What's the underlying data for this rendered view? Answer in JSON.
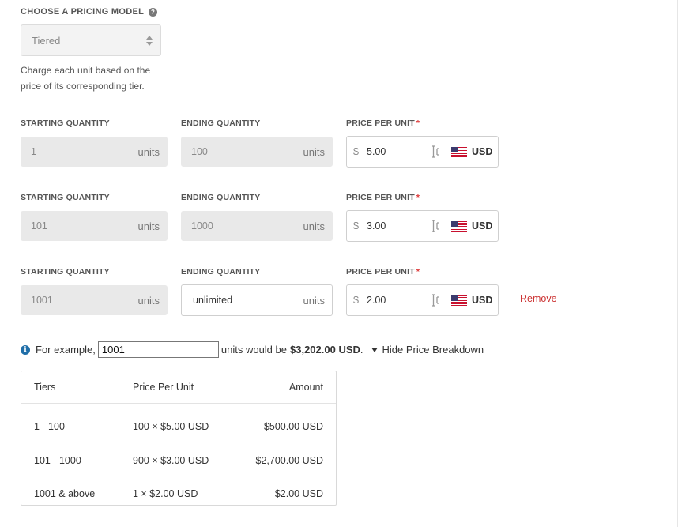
{
  "pricing_model": {
    "label": "CHOOSE A PRICING MODEL",
    "help_icon": "?",
    "selected": "Tiered",
    "description": "Charge each unit based on the price of its corresponding tier."
  },
  "columns": {
    "start": "STARTING QUANTITY",
    "end": "ENDING QUANTITY",
    "price": "PRICE PER UNIT",
    "required_mark": "*"
  },
  "tiers": [
    {
      "start": "1",
      "start_unit": "units",
      "end": "100",
      "end_unit": "units",
      "currency_symbol": "$",
      "price": "5.00",
      "currency": "USD"
    },
    {
      "start": "101",
      "start_unit": "units",
      "end": "1000",
      "end_unit": "units",
      "currency_symbol": "$",
      "price": "3.00",
      "currency": "USD"
    },
    {
      "start": "1001",
      "start_unit": "units",
      "end": "unlimited",
      "end_unit": "units",
      "currency_symbol": "$",
      "price": "2.00",
      "currency": "USD",
      "remove_label": "Remove"
    }
  ],
  "example": {
    "info_icon": "i",
    "prefix": "For example,",
    "quantity": "1001",
    "middle": "units would be",
    "total": "$3,202.00 USD",
    "suffix": ".",
    "toggle_label": "Hide Price Breakdown"
  },
  "breakdown": {
    "headers": [
      "Tiers",
      "Price Per Unit",
      "Amount"
    ],
    "rows": [
      {
        "tier": "1 - 100",
        "ppu": "100 × $5.00 USD",
        "amount": "$500.00 USD"
      },
      {
        "tier": "101 - 1000",
        "ppu": "900 × $3.00 USD",
        "amount": "$2,700.00 USD"
      },
      {
        "tier": "1001 & above",
        "ppu": "1 × $2.00 USD",
        "amount": "$2.00 USD"
      }
    ]
  },
  "colors": {
    "remove": "#cc3333",
    "info": "#1f6ea8",
    "disabled_field": "#e9e9e9"
  }
}
